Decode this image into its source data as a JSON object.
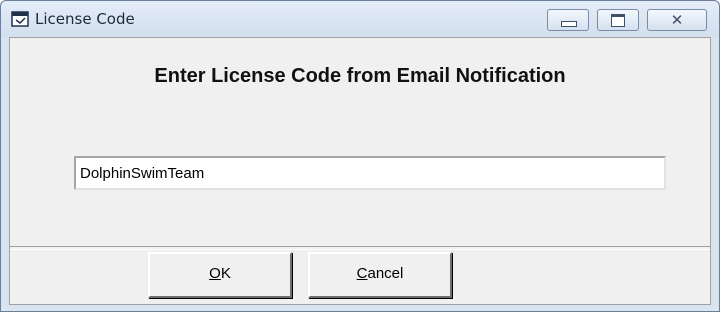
{
  "window": {
    "title": "License Code",
    "icon": "application-window-icon"
  },
  "caption_buttons": {
    "minimize": "minimize-icon",
    "maximize": "maximize-icon",
    "close": "close-icon",
    "close_glyph": "✕"
  },
  "dialog": {
    "heading": "Enter License Code from Email Notification",
    "license_value": "DolphinSwimTeam"
  },
  "buttons": {
    "ok": {
      "accel": "O",
      "rest": "K"
    },
    "cancel": {
      "accel": "C",
      "rest": "ancel"
    }
  },
  "colors": {
    "titlebar": "#d9e4f1",
    "client": "#f0f0f0",
    "text": "#111111"
  }
}
